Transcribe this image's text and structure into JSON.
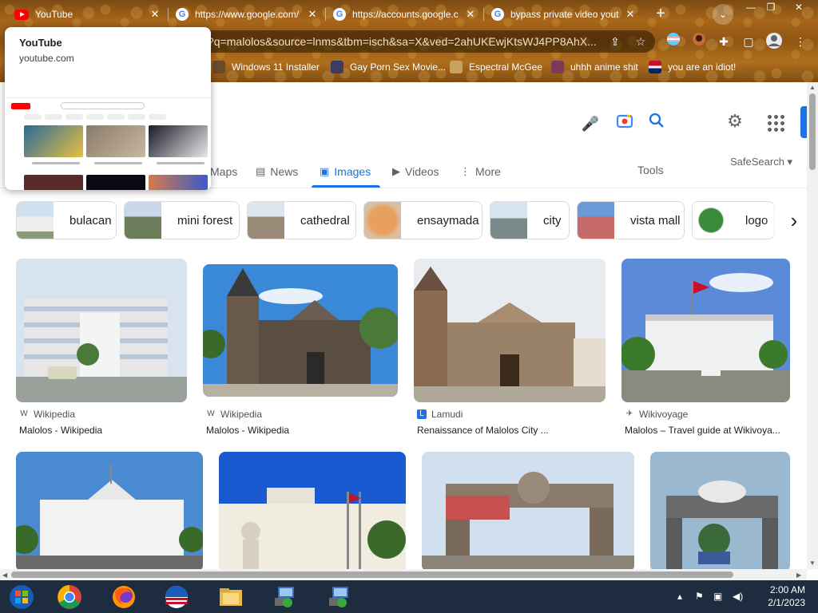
{
  "browser": {
    "tabs": [
      {
        "title": "YouTube",
        "favicon": "youtube-icon",
        "active": false
      },
      {
        "title": "https://www.google.com/",
        "favicon": "google-icon"
      },
      {
        "title": "https://accounts.google.c",
        "favicon": "google-icon"
      },
      {
        "title": "bypass private video yout",
        "favicon": "google-icon"
      }
    ],
    "close_glyph": "✕",
    "new_tab_glyph": "+",
    "tab_search_glyph": "⌄",
    "window_controls": {
      "minimize": "—",
      "restore": "❐",
      "close": "✕"
    },
    "url": "?q=malolos&source=lnms&tbm=isch&sa=X&ved=2ahUKEwjKtsWJ4PP8AhX...",
    "bookmarks": [
      {
        "label": "Windows 11 Installer",
        "icon": "installer-icon",
        "color": "#6b4a2a"
      },
      {
        "label": "Gay Porn Sex Movie...",
        "icon": "mascot-icon",
        "color": "#3c3c64"
      },
      {
        "label": "Espectral McGee",
        "icon": "character-icon",
        "color": "#c8a060"
      },
      {
        "label": "uhhh anime shit",
        "icon": "anime-icon",
        "color": "#7a3a5a"
      },
      {
        "label": "you are an idiot!",
        "icon": "flag-icon",
        "color": "#c8102e"
      }
    ],
    "hover_card": {
      "title": "YouTube",
      "url": "youtube.com"
    }
  },
  "google": {
    "nav": [
      {
        "label": "Maps",
        "icon": ""
      },
      {
        "label": "News",
        "icon": "▤"
      },
      {
        "label": "Images",
        "icon": "▣"
      },
      {
        "label": "Videos",
        "icon": "▶"
      },
      {
        "label": "More",
        "icon": "⋮"
      }
    ],
    "tools": "Tools",
    "safesearch": "SafeSearch ▾",
    "chips": [
      {
        "label": "bulacan",
        "color": "#8a9aa8"
      },
      {
        "label": "mini forest",
        "color": "#6b7d5a"
      },
      {
        "label": "cathedral",
        "color": "#9a8a78"
      },
      {
        "label": "ensaymada",
        "color": "#e8a060"
      },
      {
        "label": "city",
        "color": "#7a8a8a"
      },
      {
        "label": "vista mall",
        "color": "#c86a6a"
      },
      {
        "label": "logo",
        "color": "#3a8a3a"
      }
    ],
    "results_row1": [
      {
        "source": "Wikipedia",
        "title": "Malolos - Wikipedia",
        "src_icon": "W"
      },
      {
        "source": "Wikipedia",
        "title": "Malolos - Wikipedia",
        "src_icon": "W"
      },
      {
        "source": "Lamudi",
        "title": "Renaissance of Malolos City ...",
        "src_icon": "L"
      },
      {
        "source": "Wikivoyage",
        "title": "Malolos – Travel guide at Wikivoya...",
        "src_icon": "✈"
      }
    ]
  },
  "taskbar": {
    "time": "2:00 AM",
    "date": "2/1/2023",
    "tray_icons": [
      "▴",
      "⚑",
      "▣",
      "◀)"
    ]
  },
  "colors": {
    "accent": "#1a73e8",
    "taskbar": "#1d2d3f"
  }
}
